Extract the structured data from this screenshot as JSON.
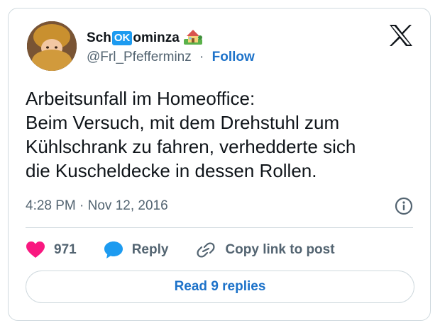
{
  "author": {
    "name_prefix": "Sch",
    "name_badge": "OK",
    "name_suffix": "ominza",
    "handle": "@Frl_Pfefferminz",
    "separator": "·",
    "follow_label": "Follow"
  },
  "tweet": {
    "lines": [
      "Arbeitsunfall im Homeoffice:",
      "Beim Versuch, mit dem Drehstuhl zum",
      "Kühlschrank zu fahren, verhedderte sich",
      "die Kuscheldecke in dessen Rollen."
    ],
    "time": "4:28 PM · Nov 12, 2016"
  },
  "actions": {
    "like_count": "971",
    "reply_label": "Reply",
    "copy_label": "Copy link to post"
  },
  "read_replies_label": "Read 9 replies",
  "colors": {
    "accent": "#1d72c9",
    "like": "#f91880",
    "reply": "#1d9bf0",
    "muted": "#536471",
    "border": "#cfd9de"
  }
}
